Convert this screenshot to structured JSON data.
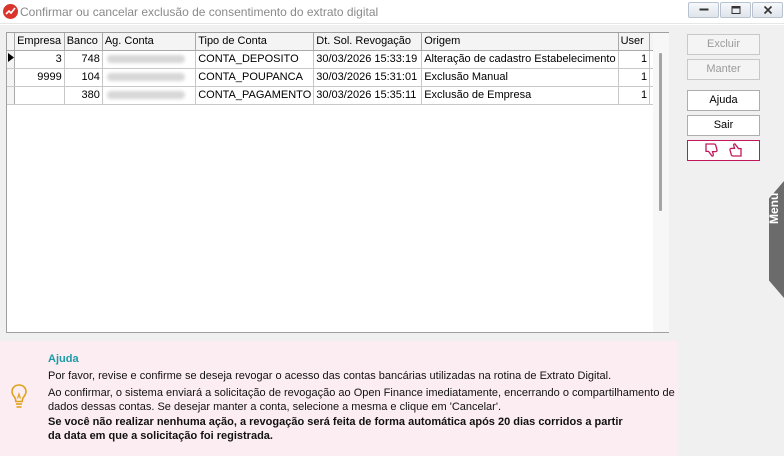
{
  "window": {
    "title": "Confirmar ou cancelar exclusão de consentimento do extrato digital"
  },
  "grid": {
    "columns": [
      "Empresa",
      "Banco",
      "Ag. Conta",
      "Tipo de Conta",
      "Dt. Sol. Revogação",
      "Origem",
      "User"
    ],
    "rows": [
      {
        "empresa": "3",
        "banco": "748",
        "tipo": "CONTA_DEPOSITO",
        "dt": "30/03/2026 15:33:19",
        "origem": "Alteração de cadastro Estabelecimento",
        "user": "1",
        "selected": false,
        "current": true
      },
      {
        "empresa": "9999",
        "banco": "104",
        "tipo": "CONTA_POUPANCA",
        "dt": "30/03/2026 15:31:01",
        "origem": "Exclusão Manual",
        "user": "1",
        "selected": false,
        "current": false
      },
      {
        "empresa": "",
        "banco": "380",
        "tipo": "CONTA_PAGAMENTO",
        "dt": "30/03/2026 15:35:11",
        "origem": "Exclusão de Empresa",
        "user": "1",
        "selected": false,
        "current": false
      }
    ]
  },
  "buttons": {
    "excluir": "Excluir",
    "manter": "Manter",
    "ajuda": "Ajuda",
    "sair": "Sair"
  },
  "side_menu": {
    "label": "Menu"
  },
  "help": {
    "title": "Ajuda",
    "line1": "Por favor, revise e confirme se deseja revogar o acesso das contas bancárias utilizadas na rotina de Extrato Digital.",
    "line2": "Ao confirmar, o sistema enviará a solicitação de revogação ao Open Finance imediatamente, encerrando o compartilhamento de",
    "line3": "dados dessas contas. Se desejar manter a conta, selecione a mesma e clique em 'Cancelar'.",
    "line4": "Se você não realizar nenhuma ação, a revogação será feita de forma automática após 20 dias corridos a partir",
    "line5": "da data em que a solicitação foi registrada."
  },
  "colors": {
    "help_background": "#fcedf2",
    "help_title": "#1b9aa8",
    "feedback_border": "#c2185b",
    "app_icon": "#d9352c"
  }
}
